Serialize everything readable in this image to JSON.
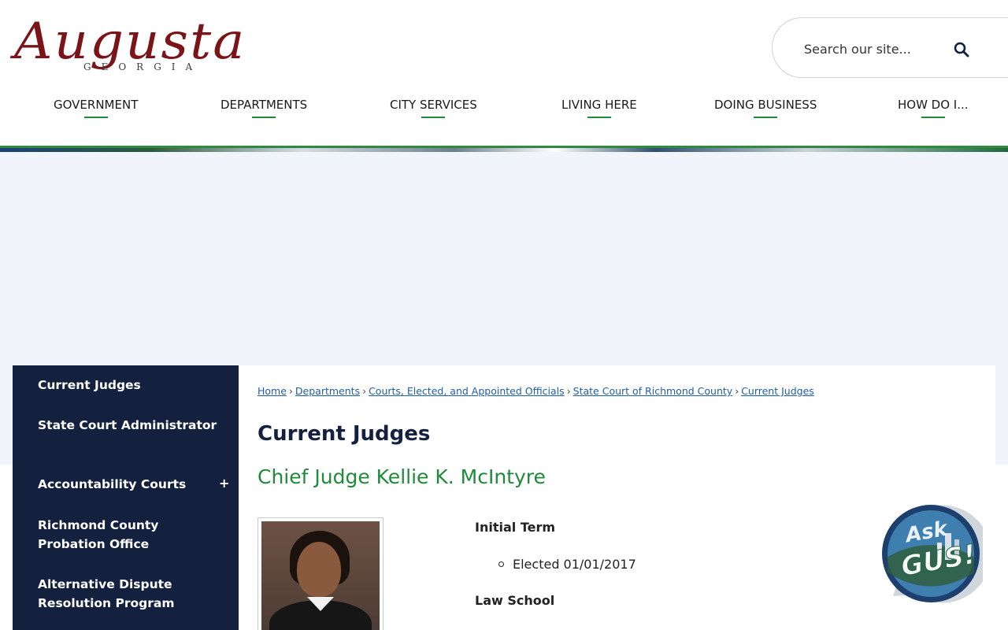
{
  "logo": {
    "script": "Augusta",
    "sub": "GEORGIA"
  },
  "search": {
    "placeholder": "Search our site..."
  },
  "nav": {
    "items": [
      {
        "label": "GOVERNMENT"
      },
      {
        "label": "DEPARTMENTS"
      },
      {
        "label": "CITY SERVICES"
      },
      {
        "label": "LIVING HERE"
      },
      {
        "label": "DOING BUSINESS"
      },
      {
        "label": "HOW DO I..."
      }
    ]
  },
  "sidebar": {
    "items": [
      {
        "label": "Current Judges"
      },
      {
        "label": "State Court Administrator"
      },
      {
        "label": "Accountability Courts",
        "expand": "+"
      },
      {
        "label": "Richmond County Probation Office"
      },
      {
        "label": "Alternative Dispute Resolution Program"
      }
    ]
  },
  "breadcrumb": {
    "items": [
      {
        "label": "Home"
      },
      {
        "label": "Departments"
      },
      {
        "label": "Courts, Elected, and Appointed Officials"
      },
      {
        "label": "State Court of Richmond County"
      },
      {
        "label": "Current Judges"
      }
    ],
    "separator": "›"
  },
  "page": {
    "title": "Current Judges",
    "judge_name": "Chief Judge Kellie K. McIntyre",
    "initial_term_label": "Initial Term",
    "initial_term_value": "Elected 01/01/2017",
    "law_school_label": "Law School"
  },
  "gus": {
    "line1": "Ask",
    "line2": "GUS!"
  },
  "colors": {
    "navy": "#13213f",
    "green": "#1f8a3a",
    "maroon": "#7a1419",
    "link": "#1f5ea8"
  }
}
